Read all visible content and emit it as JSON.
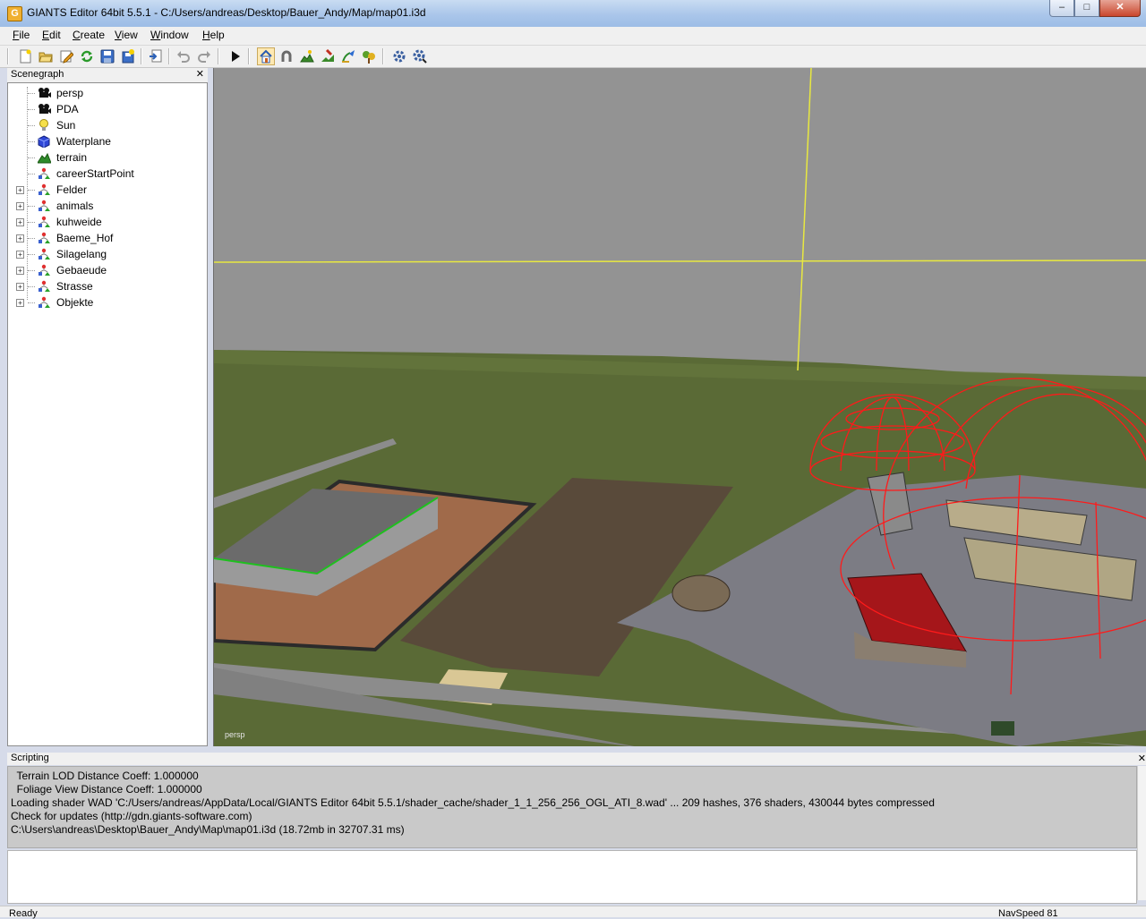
{
  "window": {
    "title": "GIANTS Editor 64bit 5.5.1 - C:/Users/andreas/Desktop/Bauer_Andy/Map/map01.i3d",
    "app_icon_letter": "G",
    "minimize_glyph": "–",
    "maximize_glyph": "□",
    "close_glyph": "✕"
  },
  "menu": [
    {
      "u": "F",
      "rest": "ile"
    },
    {
      "u": "E",
      "rest": "dit"
    },
    {
      "u": "C",
      "rest": "reate"
    },
    {
      "u": "V",
      "rest": "iew"
    },
    {
      "u": "W",
      "rest": "indow"
    },
    {
      "u": "H",
      "rest": "elp"
    }
  ],
  "toolbar": {
    "icons": [
      "new-file-icon",
      "open-folder-icon",
      "edit-icon",
      "refresh-icon",
      "save-icon",
      "save-all-icon",
      "import-icon",
      "undo-icon",
      "redo-icon",
      "play-icon",
      "home-icon",
      "magnet-icon",
      "terrain-paint-icon",
      "terrain-sculpt-icon",
      "foliage-paint-icon",
      "foliage-brush-icon",
      "settings-gear-icon",
      "settings-gear2-icon"
    ]
  },
  "scenegraph": {
    "title": "Scenegraph",
    "close_glyph": "✕",
    "items": [
      {
        "label": "persp",
        "icon": "camera-icon",
        "expandable": false
      },
      {
        "label": "PDA",
        "icon": "camera-icon",
        "expandable": false
      },
      {
        "label": "Sun",
        "icon": "lightbulb-icon",
        "expandable": false
      },
      {
        "label": "Waterplane",
        "icon": "cube-icon",
        "expandable": false
      },
      {
        "label": "terrain",
        "icon": "terrain-icon",
        "expandable": false
      },
      {
        "label": "careerStartPoint",
        "icon": "transform-group-icon",
        "expandable": false
      },
      {
        "label": "Felder",
        "icon": "transform-group-icon",
        "expandable": true
      },
      {
        "label": "animals",
        "icon": "transform-group-icon",
        "expandable": true
      },
      {
        "label": "kuhweide",
        "icon": "transform-group-icon",
        "expandable": true
      },
      {
        "label": "Baeme_Hof",
        "icon": "transform-group-icon",
        "expandable": true
      },
      {
        "label": "Silagelang",
        "icon": "transform-group-icon",
        "expandable": true
      },
      {
        "label": "Gebaeude",
        "icon": "transform-group-icon",
        "expandable": true
      },
      {
        "label": "Strasse",
        "icon": "transform-group-icon",
        "expandable": true
      },
      {
        "label": "Objekte",
        "icon": "transform-group-icon",
        "expandable": true
      }
    ]
  },
  "viewport": {
    "camera_label": "persp",
    "sky_color": "#939393",
    "grass_color": "#5b6a36",
    "selection_color": "#ff0000",
    "axis_color": "#ffff33"
  },
  "scripting": {
    "title": "Scripting",
    "close_glyph": "✕",
    "lines": [
      "  Terrain LOD Distance Coeff: 1.000000",
      "  Foliage View Distance Coeff: 1.000000",
      "Loading shader WAD 'C:/Users/andreas/AppData/Local/GIANTS Editor 64bit 5.5.1/shader_cache/shader_1_1_256_256_OGL_ATI_8.wad' ... 209 hashes, 376 shaders, 430044 bytes compressed",
      "Check for updates (http://gdn.giants-software.com)",
      "C:\\Users\\andreas\\Desktop\\Bauer_Andy\\Map\\map01.i3d (18.72mb in 32707.31 ms)"
    ]
  },
  "status": {
    "left": "Ready",
    "right": "NavSpeed 81"
  }
}
